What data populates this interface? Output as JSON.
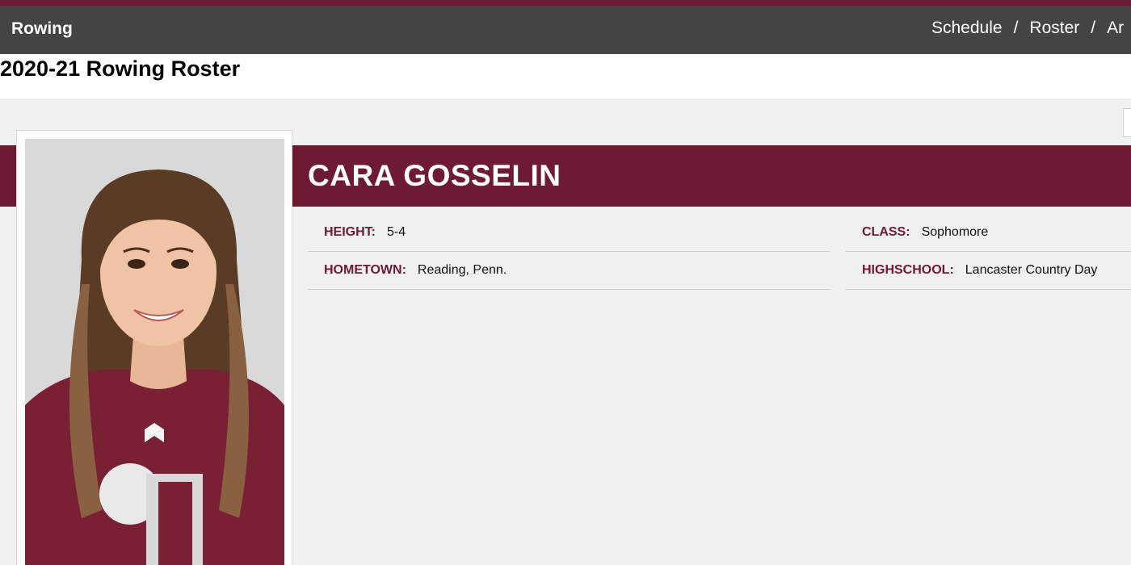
{
  "nav": {
    "sport": "Rowing",
    "links": [
      "Schedule",
      "Roster",
      "Ar"
    ],
    "separator": "/"
  },
  "page": {
    "title": "2020-21 Rowing Roster"
  },
  "player": {
    "name": "CARA GOSSELIN",
    "fields": {
      "height": {
        "label": "HEIGHT:",
        "value": "5-4"
      },
      "hometown": {
        "label": "HOMETOWN:",
        "value": "Reading, Penn."
      },
      "class": {
        "label": "CLASS:",
        "value": "Sophomore"
      },
      "highschool": {
        "label": "HIGHSCHOOL:",
        "value": "Lancaster Country Day"
      }
    }
  },
  "colors": {
    "brand": "#6e1a33",
    "nav_bg": "#444444",
    "content_bg": "#f0f0f0"
  }
}
